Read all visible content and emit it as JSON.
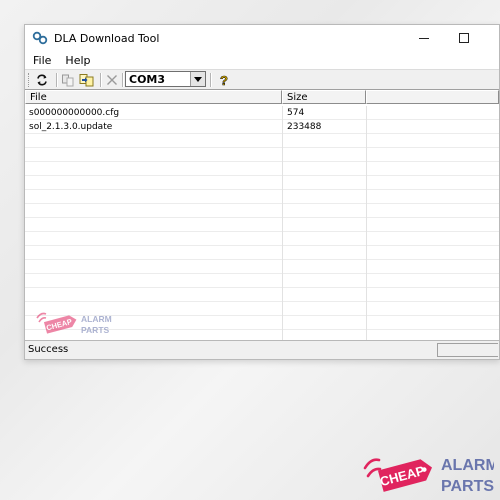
{
  "window": {
    "title": "DLA Download Tool",
    "menu": [
      "File",
      "Help"
    ]
  },
  "toolbar": {
    "buttons": [
      "refresh-icon",
      "copy-icon",
      "download-icon",
      "delete-icon",
      "help-icon"
    ],
    "port": "COM3"
  },
  "list": {
    "columns": [
      "File",
      "Size"
    ],
    "rows": [
      {
        "file": "s000000000000.cfg",
        "size": "574"
      },
      {
        "file": "sol_2.1.3.0.update",
        "size": "233488"
      }
    ]
  },
  "status": {
    "text": "Success"
  },
  "watermark": {
    "word1": "CHEAP",
    "word2": "ALARM",
    "word3": "PARTS"
  },
  "brand": {
    "word1": "CHEAP",
    "word2": "ALARM",
    "word3": "PARTS",
    "accent": "#e0245e",
    "secondary": "#6a76ad"
  }
}
